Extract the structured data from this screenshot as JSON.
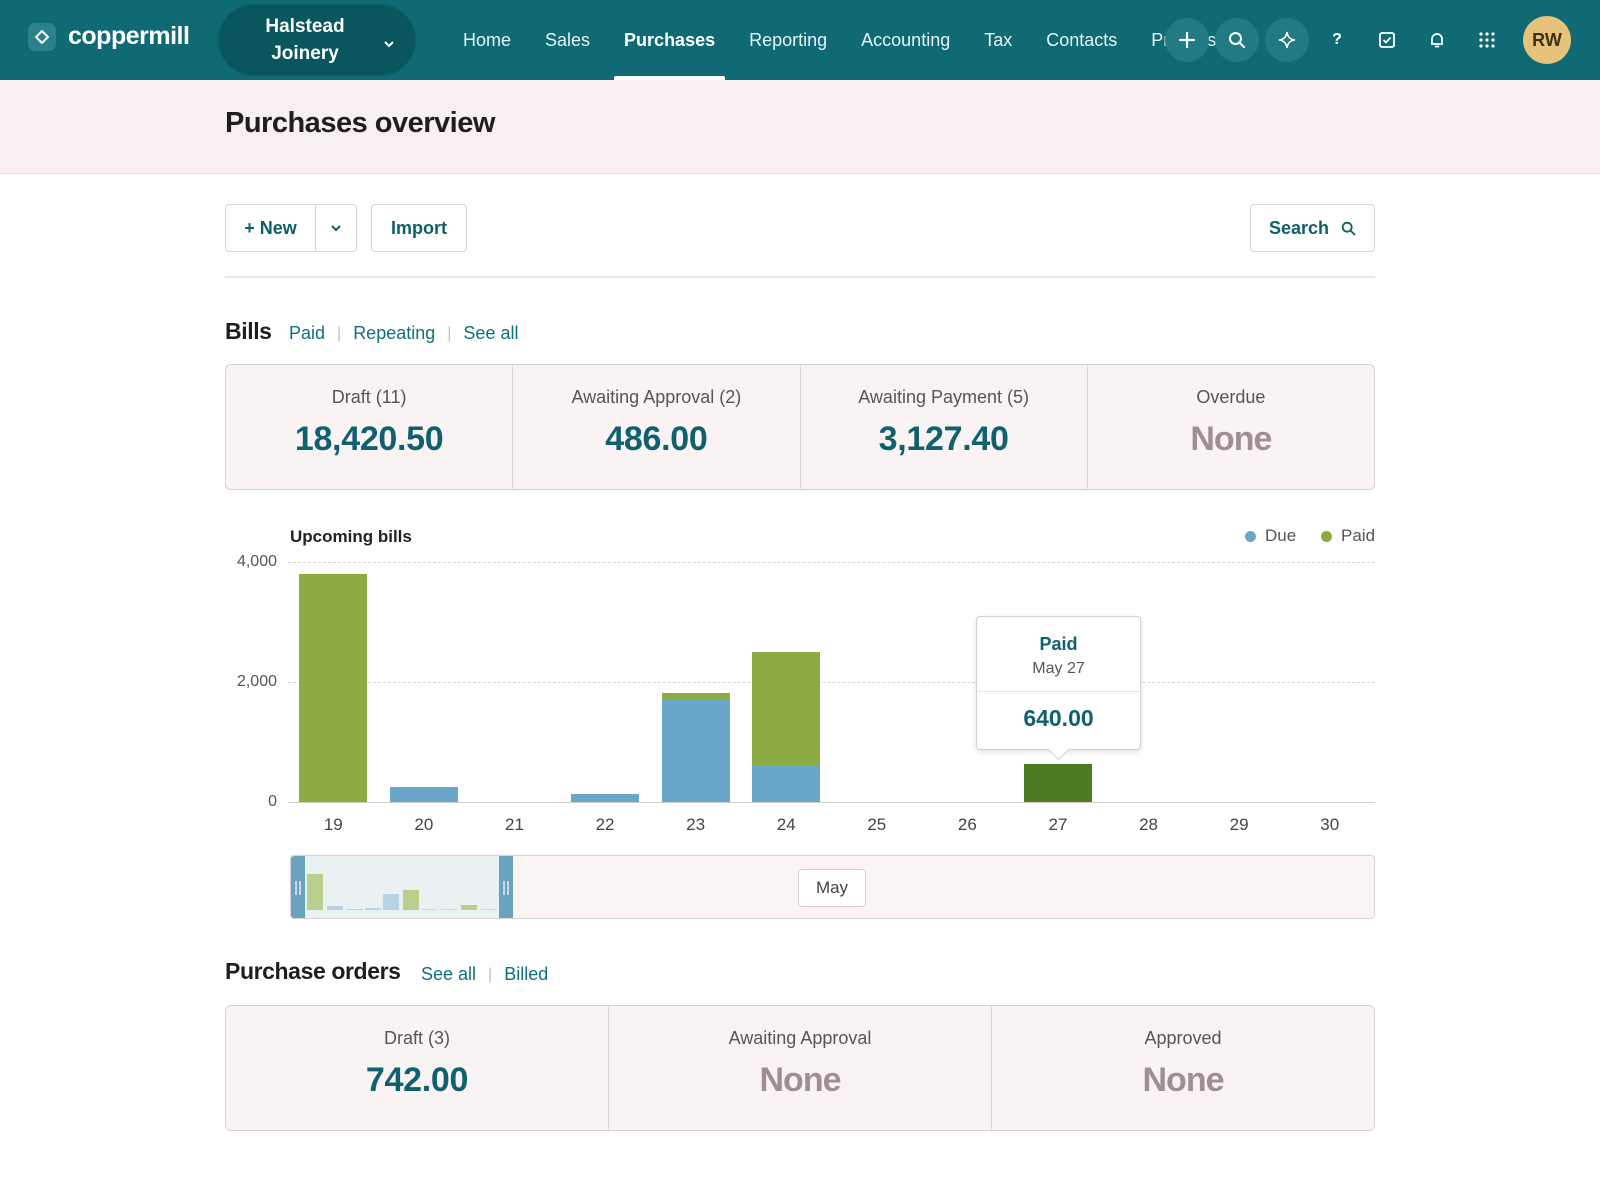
{
  "app": {
    "brand": "coppermill",
    "org_name": "Halstead Joinery"
  },
  "nav": {
    "items": [
      {
        "label": "Home",
        "active": false
      },
      {
        "label": "Sales",
        "active": false
      },
      {
        "label": "Purchases",
        "active": true
      },
      {
        "label": "Reporting",
        "active": false
      },
      {
        "label": "Accounting",
        "active": false
      },
      {
        "label": "Tax",
        "active": false
      },
      {
        "label": "Contacts",
        "active": false
      },
      {
        "label": "Projects",
        "active": false
      }
    ],
    "icons": [
      "plus-icon",
      "search-icon",
      "sparkle-icon",
      "help-icon",
      "tasks-icon",
      "bell-icon",
      "app-grid-icon"
    ],
    "help_label": "?",
    "avatar_initials": "RW"
  },
  "page": {
    "title": "Purchases overview"
  },
  "toolbar": {
    "new_label": "+ New",
    "import_label": "Import",
    "search_label": "Search"
  },
  "bills": {
    "title": "Bills",
    "links": [
      "Paid",
      "Repeating",
      "See all"
    ],
    "cards": [
      {
        "label": "Draft (11)",
        "value": "18,420.50",
        "none": false
      },
      {
        "label": "Awaiting Approval (2)",
        "value": "486.00",
        "none": false
      },
      {
        "label": "Awaiting Payment (5)",
        "value": "3,127.40",
        "none": false
      },
      {
        "label": "Overdue",
        "value": "None",
        "none": true
      }
    ]
  },
  "chart": {
    "title": "Upcoming bills",
    "legend": [
      {
        "name": "Due",
        "color": "#6aa6c8"
      },
      {
        "name": "Paid",
        "color": "#8cab41"
      }
    ],
    "y_ticks": [
      "4,000",
      "2,000",
      "0"
    ],
    "tooltip": {
      "series": "Paid",
      "date": "May 27",
      "value": "640.00"
    },
    "navigator_label": "May"
  },
  "chart_data": {
    "type": "bar",
    "stacked": true,
    "title": "Upcoming bills",
    "categories": [
      "19",
      "20",
      "21",
      "22",
      "23",
      "24",
      "25",
      "26",
      "27",
      "28",
      "29",
      "30"
    ],
    "series": [
      {
        "name": "Due",
        "color": "#6aa6c8",
        "values": [
          0,
          250,
          0,
          130,
          1720,
          620,
          0,
          0,
          0,
          0,
          0,
          0
        ]
      },
      {
        "name": "Paid",
        "color": "#8cab41",
        "values": [
          3800,
          0,
          0,
          0,
          100,
          1880,
          0,
          0,
          640,
          0,
          0,
          0
        ]
      }
    ],
    "highlight": {
      "category": "27",
      "series": "Paid",
      "color": "#4d7a22"
    },
    "ylim": [
      0,
      4000
    ],
    "y_ticks": [
      0,
      2000,
      4000
    ],
    "grid": true,
    "legend_position": "top-right",
    "xlabel": "",
    "ylabel": ""
  },
  "purchase_orders": {
    "title": "Purchase orders",
    "links": [
      "See all",
      "Billed"
    ],
    "cards": [
      {
        "label": "Draft (3)",
        "value": "742.00",
        "none": false
      },
      {
        "label": "Awaiting Approval",
        "value": "None",
        "none": true
      },
      {
        "label": "Approved",
        "value": "None",
        "none": true
      }
    ]
  }
}
